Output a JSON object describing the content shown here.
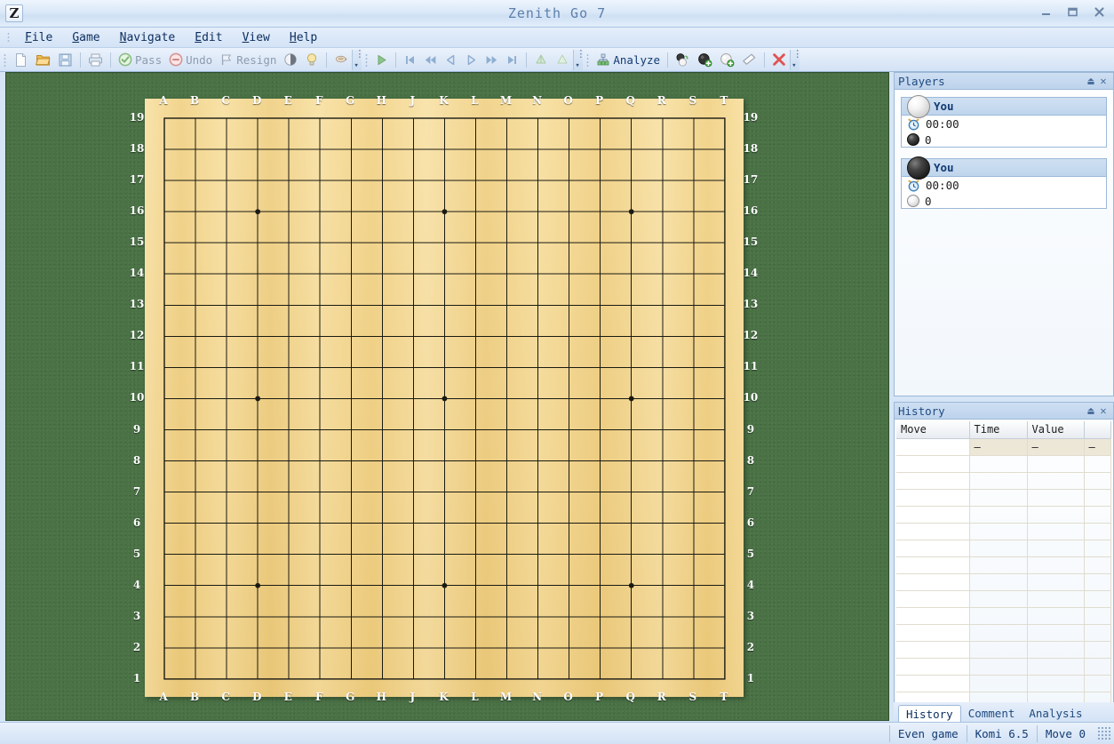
{
  "window": {
    "title": "Zenith Go 7",
    "logo_glyph": "Z",
    "controls": [
      {
        "name": "minimize",
        "label": "–"
      },
      {
        "name": "maximize",
        "label": "□"
      },
      {
        "name": "close",
        "label": "✕"
      }
    ]
  },
  "menubar": {
    "items": [
      {
        "mnemonic": "F",
        "rest": "ile"
      },
      {
        "mnemonic": "G",
        "rest": "ame"
      },
      {
        "mnemonic": "N",
        "rest": "avigate"
      },
      {
        "mnemonic": "E",
        "rest": "dit"
      },
      {
        "mnemonic": "V",
        "rest": "iew"
      },
      {
        "mnemonic": "H",
        "rest": "elp"
      }
    ]
  },
  "toolbar": {
    "group1": [
      {
        "icon": "new-file-icon",
        "label": "",
        "enabled": false
      },
      {
        "icon": "open-folder-icon",
        "label": "",
        "enabled": true
      },
      {
        "icon": "save-disk-icon",
        "label": "",
        "enabled": false
      },
      {
        "icon": "print-icon",
        "label": "",
        "enabled": false
      },
      {
        "icon": "pass-icon",
        "label": "Pass",
        "enabled": false
      },
      {
        "icon": "undo-icon",
        "label": "Undo",
        "enabled": false
      },
      {
        "icon": "resign-icon",
        "label": "Resign",
        "enabled": false
      },
      {
        "icon": "score-estimate-icon",
        "label": "",
        "enabled": false
      },
      {
        "icon": "hint-bulb-icon",
        "label": "",
        "enabled": false
      },
      {
        "icon": "coffee-cup-icon",
        "label": "",
        "enabled": false
      }
    ],
    "group2": [
      {
        "icon": "play-icon",
        "label": "",
        "enabled": false
      },
      {
        "icon": "first-move-icon",
        "label": "",
        "enabled": false
      },
      {
        "icon": "rewind-icon",
        "label": "",
        "enabled": false
      },
      {
        "icon": "prev-move-icon",
        "label": "",
        "enabled": false
      },
      {
        "icon": "next-move-icon",
        "label": "",
        "enabled": false
      },
      {
        "icon": "forward-icon",
        "label": "",
        "enabled": false
      },
      {
        "icon": "last-move-icon",
        "label": "",
        "enabled": false
      },
      {
        "icon": "branch-up-icon",
        "label": "",
        "enabled": false
      },
      {
        "icon": "branch-down-icon",
        "label": "",
        "enabled": false
      }
    ],
    "group3": [
      {
        "icon": "analyze-icon",
        "label": "Analyze",
        "enabled": true
      },
      {
        "icon": "alternate-stone-icon",
        "label": "",
        "enabled": true
      },
      {
        "icon": "add-black-stone-icon",
        "label": "",
        "enabled": true
      },
      {
        "icon": "add-white-stone-icon",
        "label": "",
        "enabled": true
      },
      {
        "icon": "eraser-icon",
        "label": "",
        "enabled": true
      },
      {
        "icon": "delete-icon",
        "label": "",
        "enabled": true
      }
    ]
  },
  "board": {
    "size": 19,
    "column_labels": [
      "A",
      "B",
      "C",
      "D",
      "E",
      "F",
      "G",
      "H",
      "J",
      "K",
      "L",
      "M",
      "N",
      "O",
      "P",
      "Q",
      "R",
      "S",
      "T"
    ],
    "row_labels": [
      "19",
      "18",
      "17",
      "16",
      "15",
      "14",
      "13",
      "12",
      "11",
      "10",
      "9",
      "8",
      "7",
      "6",
      "5",
      "4",
      "3",
      "2",
      "1"
    ],
    "star_points": [
      {
        "col": 3,
        "row": 3
      },
      {
        "col": 9,
        "row": 3
      },
      {
        "col": 15,
        "row": 3
      },
      {
        "col": 3,
        "row": 9
      },
      {
        "col": 9,
        "row": 9
      },
      {
        "col": 15,
        "row": 9
      },
      {
        "col": 3,
        "row": 15
      },
      {
        "col": 9,
        "row": 15
      },
      {
        "col": 15,
        "row": 15
      }
    ],
    "stones": [],
    "wood_color": "#f2d285",
    "felt_color": "#4a7245",
    "line_color": "#1a1a12"
  },
  "players_panel": {
    "title": "Players",
    "pin_glyph": "⏏",
    "close_glyph": "✕",
    "players": [
      {
        "color": "white",
        "name": "You",
        "clock_icon": "alarm-clock-icon",
        "clock": "00:00",
        "captures_stone": "black",
        "captures": "0"
      },
      {
        "color": "black",
        "name": "You",
        "clock_icon": "alarm-clock-icon",
        "clock": "00:00",
        "captures_stone": "white",
        "captures": "0"
      }
    ]
  },
  "history_panel": {
    "title": "History",
    "pin_glyph": "⏏",
    "close_glyph": "✕",
    "columns": [
      "Move",
      "Time",
      "Value",
      ""
    ],
    "rows": [
      {
        "selected": true,
        "cells": [
          "",
          "–",
          "–",
          "–"
        ]
      },
      {
        "selected": false,
        "cells": [
          "",
          "",
          "",
          ""
        ]
      },
      {
        "selected": false,
        "cells": [
          "",
          "",
          "",
          ""
        ]
      },
      {
        "selected": false,
        "cells": [
          "",
          "",
          "",
          ""
        ]
      },
      {
        "selected": false,
        "cells": [
          "",
          "",
          "",
          ""
        ]
      },
      {
        "selected": false,
        "cells": [
          "",
          "",
          "",
          ""
        ]
      },
      {
        "selected": false,
        "cells": [
          "",
          "",
          "",
          ""
        ]
      },
      {
        "selected": false,
        "cells": [
          "",
          "",
          "",
          ""
        ]
      },
      {
        "selected": false,
        "cells": [
          "",
          "",
          "",
          ""
        ]
      },
      {
        "selected": false,
        "cells": [
          "",
          "",
          "",
          ""
        ]
      },
      {
        "selected": false,
        "cells": [
          "",
          "",
          "",
          ""
        ]
      },
      {
        "selected": false,
        "cells": [
          "",
          "",
          "",
          ""
        ]
      },
      {
        "selected": false,
        "cells": [
          "",
          "",
          "",
          ""
        ]
      },
      {
        "selected": false,
        "cells": [
          "",
          "",
          "",
          ""
        ]
      },
      {
        "selected": false,
        "cells": [
          "",
          "",
          "",
          ""
        ]
      },
      {
        "selected": false,
        "cells": [
          "",
          "",
          "",
          ""
        ]
      }
    ]
  },
  "bottom_tabs": {
    "tabs": [
      {
        "label": "History",
        "active": true
      },
      {
        "label": "Comment",
        "active": false
      },
      {
        "label": "Analysis",
        "active": false
      }
    ]
  },
  "statusbar": {
    "cells": [
      {
        "name": "game-type",
        "text": "Even game"
      },
      {
        "name": "komi",
        "text": "Komi 6.5"
      },
      {
        "name": "move-number",
        "text": "Move 0"
      }
    ]
  }
}
